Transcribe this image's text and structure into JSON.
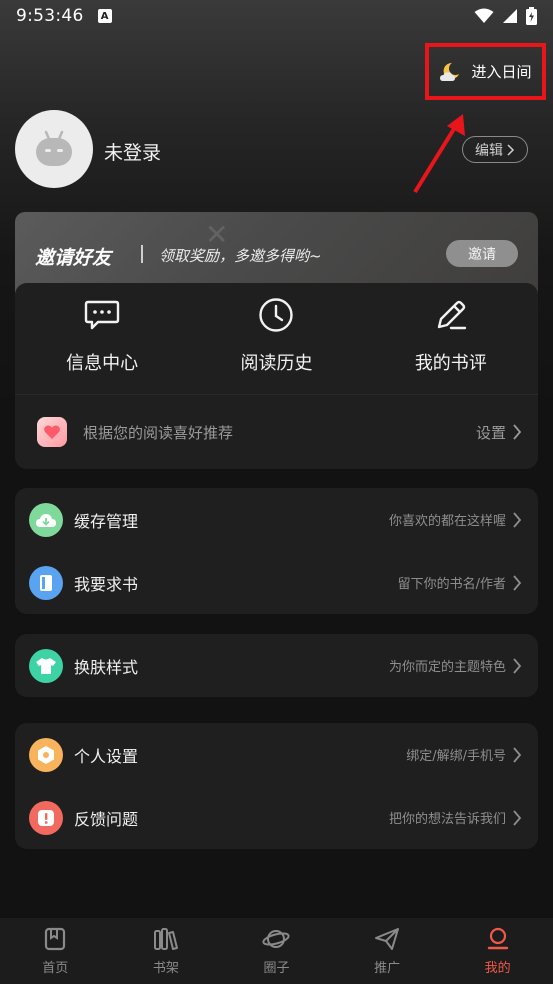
{
  "status_bar": {
    "time": "9:53:46",
    "notification_letter": "A"
  },
  "header": {
    "day_mode_label": "进入日间"
  },
  "profile": {
    "username": "未登录",
    "edit_label": "编辑"
  },
  "invite_banner": {
    "title": "邀请好友",
    "subtitle": "领取奖励，多邀多得哟~",
    "button_label": "邀请"
  },
  "features": [
    {
      "label": "信息中心",
      "icon": "message-icon"
    },
    {
      "label": "阅读历史",
      "icon": "clock-icon"
    },
    {
      "label": "我的书评",
      "icon": "pencil-icon"
    }
  ],
  "recommend": {
    "text": "根据您的阅读喜好推荐",
    "action": "设置"
  },
  "group1": [
    {
      "label": "缓存管理",
      "hint": "你喜欢的都在这样喔",
      "icon": "cloud-download-icon",
      "color": "#7ed99a"
    },
    {
      "label": "我要求书",
      "hint": "留下你的书名/作者",
      "icon": "book-icon",
      "color": "#5aa3f0"
    }
  ],
  "group2": [
    {
      "label": "换肤样式",
      "hint": "为你而定的主题特色",
      "icon": "shirt-icon",
      "color": "#3ed3a5"
    }
  ],
  "group3": [
    {
      "label": "个人设置",
      "hint": "绑定/解绑/手机号",
      "icon": "settings-icon",
      "color": "#f7b45c"
    },
    {
      "label": "反馈问题",
      "hint": "把你的想法告诉我们",
      "icon": "feedback-icon",
      "color": "#f26a5f"
    }
  ],
  "bottom_nav": [
    {
      "label": "首页",
      "icon": "home-book-icon"
    },
    {
      "label": "书架",
      "icon": "bookshelf-icon"
    },
    {
      "label": "圈子",
      "icon": "planet-icon"
    },
    {
      "label": "推广",
      "icon": "paper-plane-icon"
    },
    {
      "label": "我的",
      "icon": "profile-icon",
      "active": true
    }
  ],
  "colors": {
    "accent": "#f0584a",
    "highlight_border": "#e8161b"
  }
}
